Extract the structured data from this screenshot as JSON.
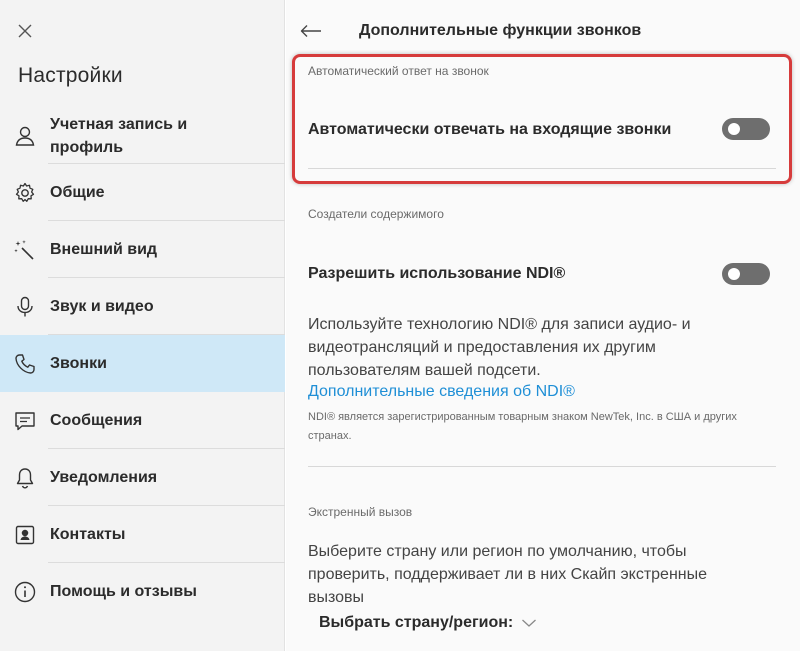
{
  "sidebar": {
    "title": "Настройки",
    "items": [
      {
        "label": "Учетная запись и профиль",
        "icon": "person-icon"
      },
      {
        "label": "Общие",
        "icon": "gear-icon"
      },
      {
        "label": "Внешний вид",
        "icon": "magic-wand-icon"
      },
      {
        "label": "Звук и видео",
        "icon": "microphone-icon"
      },
      {
        "label": "Звонки",
        "icon": "phone-icon",
        "active": true
      },
      {
        "label": "Сообщения",
        "icon": "message-icon"
      },
      {
        "label": "Уведомления",
        "icon": "bell-icon"
      },
      {
        "label": "Контакты",
        "icon": "contact-card-icon"
      },
      {
        "label": "Помощь и отзывы",
        "icon": "info-icon"
      }
    ]
  },
  "main": {
    "title": "Дополнительные функции звонков",
    "auto_answer": {
      "section": "Автоматический ответ на звонок",
      "setting": "Автоматически отвечать на входящие звонки",
      "enabled": false
    },
    "content_creators": {
      "section": "Создатели содержимого",
      "setting": "Разрешить использование NDI®",
      "enabled": false,
      "description": "Используйте технологию NDI® для записи аудио- и видеотрансляций и предоставления их другим пользователям вашей подсети.",
      "link": "Дополнительные сведения об NDI®",
      "trademark": "NDI® является зарегистрированным товарным знаком NewTek, Inc. в США и других странах."
    },
    "emergency": {
      "section": "Экстренный вызов",
      "description": "Выберите страну или регион по умолчанию, чтобы проверить, поддерживает ли в них Скайп экстренные вызовы",
      "select_label": "Выбрать страну/регион:"
    }
  },
  "colors": {
    "active_nav": "#cfe8f7",
    "highlight": "#d63b3b",
    "link": "#1f8fd6",
    "toggle_off": "#6e6e6e"
  }
}
